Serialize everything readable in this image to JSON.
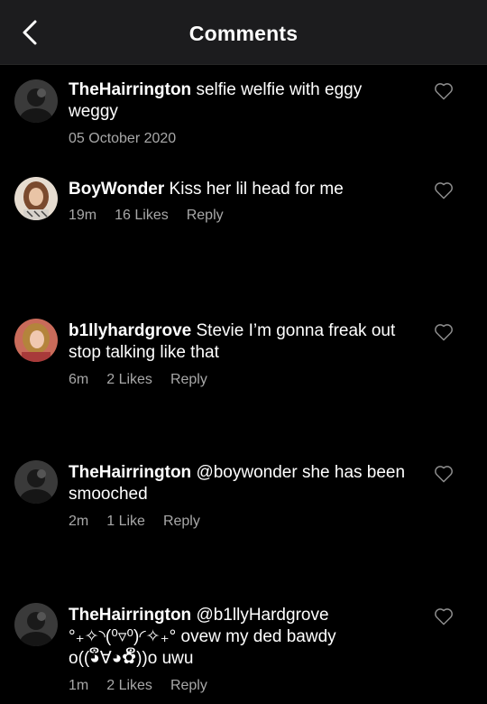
{
  "header": {
    "title": "Comments"
  },
  "comments": [
    {
      "username": "TheHairrington",
      "text": " selfie welfie with eggy weggy",
      "date": "05 October 2020"
    },
    {
      "username": "BoyWonder",
      "text": " Kiss her lil head for me",
      "time": "19m",
      "likes": "16 Likes",
      "reply": "Reply"
    },
    {
      "username": "b1llyhardgrove",
      "text": " Stevie I’m gonna freak out stop talking like that",
      "time": "6m",
      "likes": "2 Likes",
      "reply": "Reply"
    },
    {
      "username": "TheHairrington",
      "text": " @boywonder she has been smooched",
      "time": "2m",
      "likes": "1 Like",
      "reply": "Reply"
    },
    {
      "username": "TheHairrington",
      "text": " @b1llyHardgrove °₊✧◝(⁰▿⁰)◜✧₊° ovew my ded bawdy o((◕ຶ∀◕✿ຶ))o uwu",
      "time": "1m",
      "likes": "2 Likes",
      "reply": "Reply"
    }
  ],
  "colors": {
    "background": "#000000",
    "header_background": "#1c1c1e",
    "text": "#ffffff",
    "meta_text": "#a8a8a8"
  },
  "icons": {
    "back": "chevron-left-icon",
    "like": "heart-outline-icon"
  }
}
